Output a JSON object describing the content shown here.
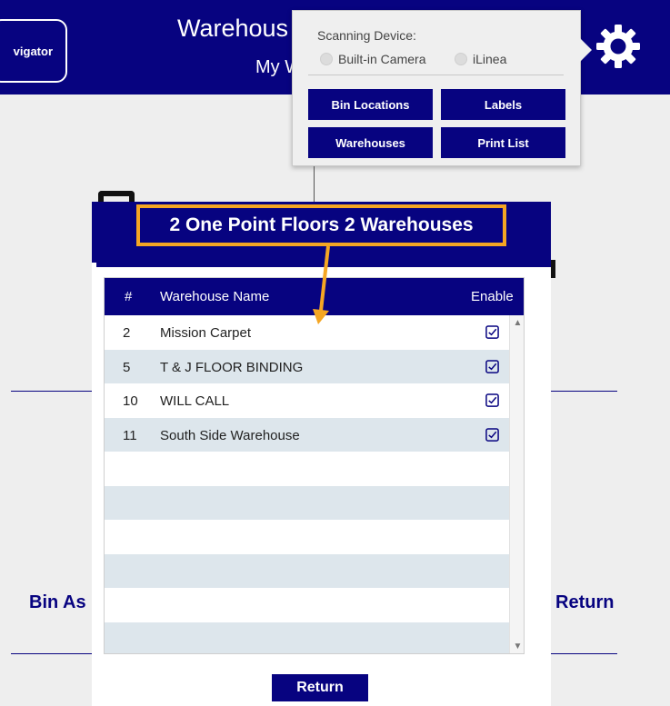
{
  "header": {
    "nav_button_label": "vigator",
    "title": "Warehous",
    "subtitle": "My W",
    "settings_icon": "gear-icon"
  },
  "settings": {
    "scanning_device_label": "Scanning Device:",
    "radio_options": [
      "Built-in Camera",
      "iLinea"
    ],
    "buttons": [
      "Bin Locations",
      "Labels",
      "Warehouses",
      "Print List"
    ]
  },
  "background": {
    "left_label": "Bin As",
    "right_label": "Return"
  },
  "modal": {
    "title": "2 One Point Floors 2 Warehouses",
    "columns": [
      "#",
      "Warehouse Name",
      "Enable"
    ],
    "rows": [
      {
        "num": "2",
        "name": "Mission Carpet",
        "enabled": true
      },
      {
        "num": "5",
        "name": "T & J FLOOR BINDING",
        "enabled": true
      },
      {
        "num": "10",
        "name": "WILL CALL",
        "enabled": true
      },
      {
        "num": "11",
        "name": "South Side Warehouse",
        "enabled": true
      }
    ],
    "return_label": "Return"
  },
  "colors": {
    "brand": "#070380",
    "highlight": "#f5a623",
    "row_alt": "#dde6ec"
  }
}
